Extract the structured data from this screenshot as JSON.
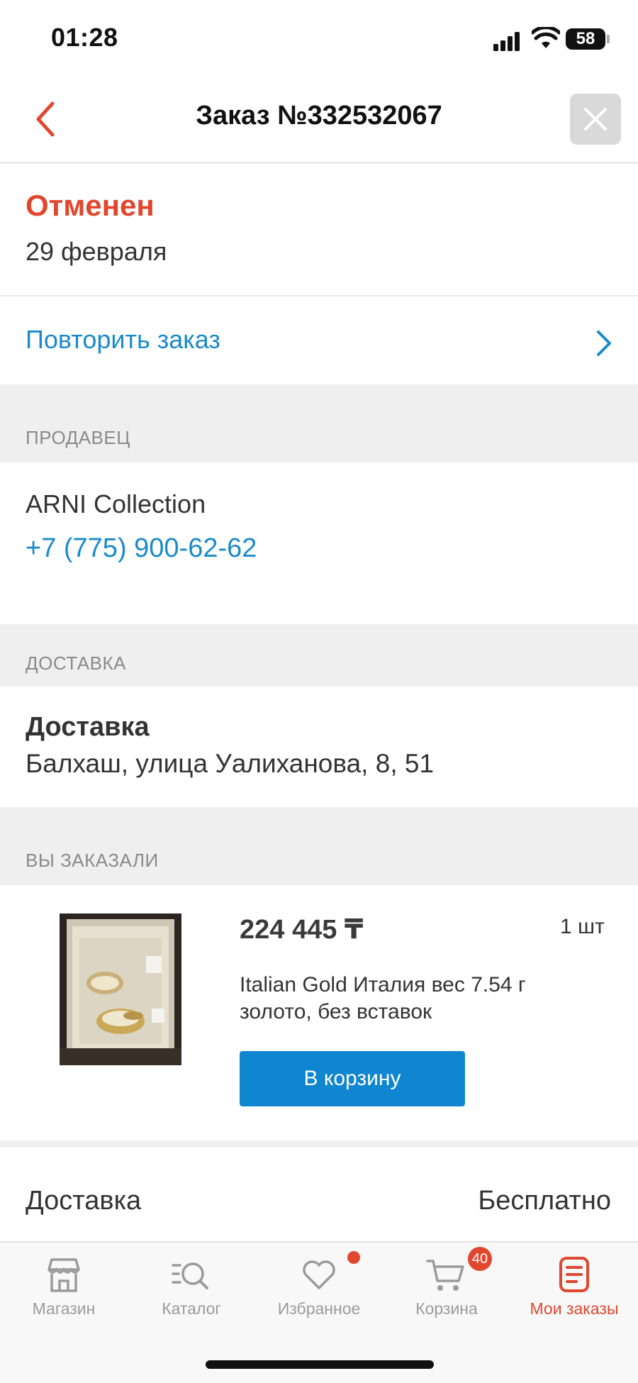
{
  "status_bar": {
    "time": "01:28",
    "battery": "58"
  },
  "header": {
    "title": "Заказ №332532067"
  },
  "order": {
    "status": "Отменен",
    "date": "29 февраля",
    "repeat_label": "Повторить заказ"
  },
  "seller_section": {
    "label": "ПРОДАВЕЦ",
    "name": "ARNI Collection",
    "phone": "+7 (775) 900-62-62"
  },
  "delivery_section": {
    "label": "ДОСТАВКА",
    "method": "Доставка",
    "address": "Балхаш, улица Уалиханова, 8, 51"
  },
  "items_section": {
    "label": "ВЫ ЗАКАЗАЛИ",
    "items": [
      {
        "price": "224 445 ₸",
        "quantity": "1 шт",
        "description": "Italian Gold Италия вес 7.54 г золото, без вставок",
        "button": "В корзину"
      }
    ]
  },
  "summary": {
    "label": "Доставка",
    "value": "Бесплатно"
  },
  "tabbar": {
    "tabs": [
      {
        "label": "Магазин",
        "icon": "shop-icon"
      },
      {
        "label": "Каталог",
        "icon": "catalog-search-icon"
      },
      {
        "label": "Избранное",
        "icon": "heart-icon"
      },
      {
        "label": "Корзина",
        "icon": "cart-icon",
        "badge": "40"
      },
      {
        "label": "Мои заказы",
        "icon": "orders-icon",
        "active": true
      }
    ]
  },
  "colors": {
    "accent": "#e1472e",
    "link": "#1a8acb",
    "button": "#0f86cf"
  }
}
